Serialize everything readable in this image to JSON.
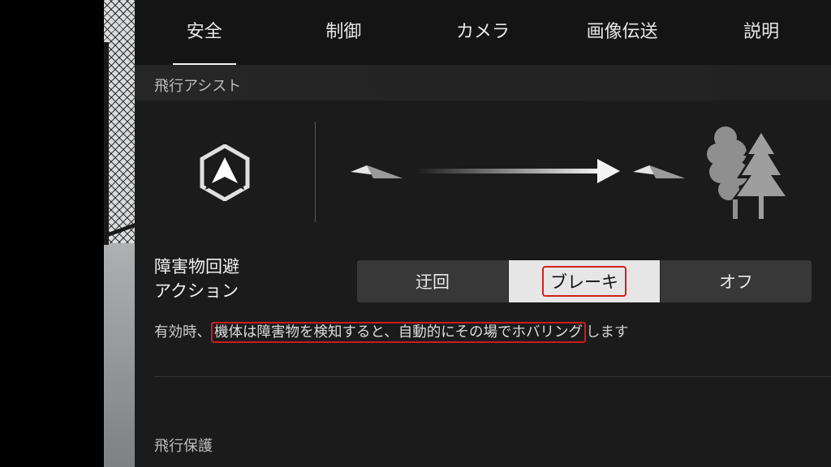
{
  "tabs": [
    {
      "label": "安全",
      "active": true
    },
    {
      "label": "制御",
      "active": false
    },
    {
      "label": "カメラ",
      "active": false
    },
    {
      "label": "画像伝送",
      "active": false
    },
    {
      "label": "説明",
      "active": false
    }
  ],
  "flight_assist": {
    "section_title": "飛行アシスト",
    "obstacle_action_label_line1": "障害物回避",
    "obstacle_action_label_line2": "アクション",
    "options": [
      "迂回",
      "ブレーキ",
      "オフ"
    ],
    "selected_option": "ブレーキ",
    "description_prefix": "有効時、",
    "description_highlight": "機体は障害物を検知すると、自動的にその場でホバリング",
    "description_suffix": "します"
  },
  "flight_protection": {
    "section_title": "飛行保護"
  },
  "icons": [
    "obstacle-avoidance-icon",
    "aircraft-icon",
    "arrow-right-icon",
    "trees-icon"
  ],
  "colors": {
    "panel_bg": "#1b1b1b",
    "selected_bg": "#e6e6e6",
    "highlight_red": "#d21f1f"
  }
}
